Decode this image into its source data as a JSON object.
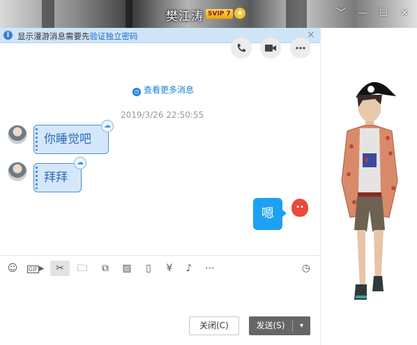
{
  "titlebar": {
    "contact_name": "樊江涛",
    "svip_badge": "SVIP 7",
    "star": "★",
    "controls": [
      "﹀",
      "—",
      "☐",
      "✕"
    ]
  },
  "notice": {
    "text_prefix": "显示漫游消息需要先",
    "link_text": "验证独立密码",
    "close": "×"
  },
  "chat": {
    "more_messages": "查看更多消息",
    "timestamp": "2019/3/26 22:50:55",
    "messages": [
      {
        "side": "left",
        "text": "你睡觉吧"
      },
      {
        "side": "left",
        "text": "拜拜"
      },
      {
        "side": "right",
        "text": "嗯"
      }
    ]
  },
  "input": {
    "close_label": "关闭(C)",
    "send_label": "发送(S)",
    "send_dropdown": "▾"
  },
  "colors": {
    "accent": "#1da1f2",
    "bubble_border": "#4a8fd8",
    "bubble_fill": "#d5e7fb",
    "notice_bg": "#cfe4f7"
  }
}
